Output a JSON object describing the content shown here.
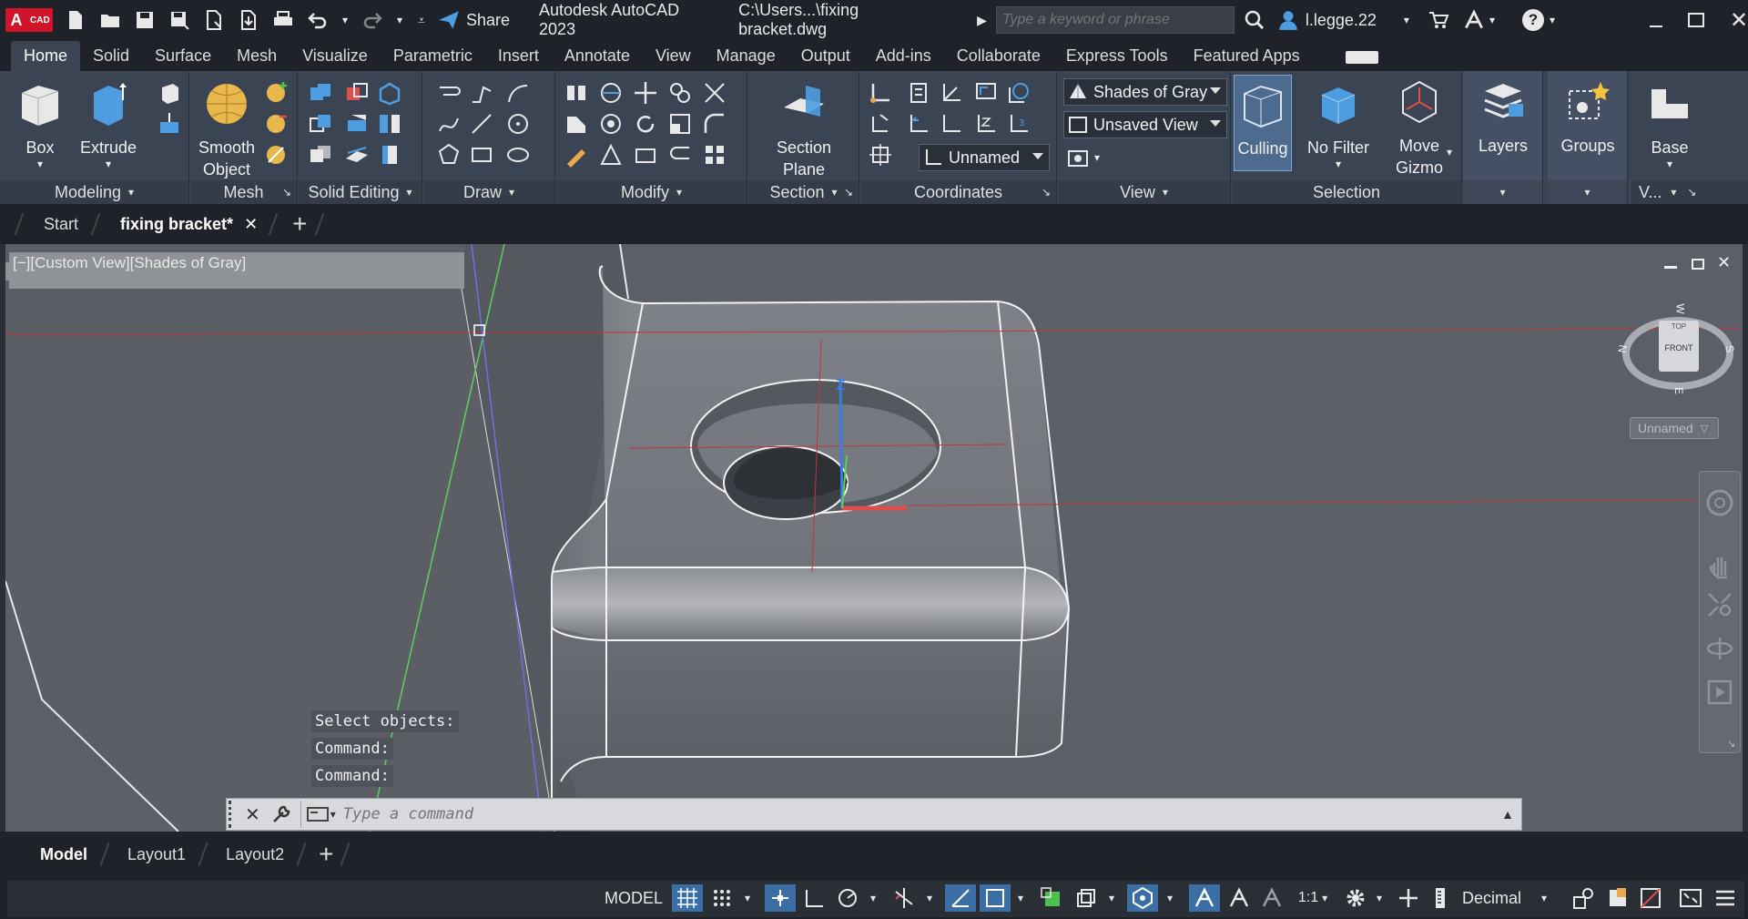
{
  "app": {
    "badge": "A",
    "badge_sub": "CAD",
    "title": "Autodesk AutoCAD 2023",
    "file": "C:\\Users...\\fixing bracket.dwg"
  },
  "quick_access": {
    "share_label": "Share"
  },
  "search": {
    "placeholder": "Type a keyword or phrase"
  },
  "user": {
    "name": "l.legge.22"
  },
  "ribbon_tabs": [
    "Home",
    "Solid",
    "Surface",
    "Mesh",
    "Visualize",
    "Parametric",
    "Insert",
    "Annotate",
    "View",
    "Manage",
    "Output",
    "Add-ins",
    "Collaborate",
    "Express Tools",
    "Featured Apps"
  ],
  "ribbon": {
    "modeling": {
      "title": "Modeling",
      "box": "Box",
      "extrude": "Extrude"
    },
    "mesh": {
      "title": "Mesh",
      "smooth1": "Smooth",
      "smooth2": "Object"
    },
    "solid_editing": {
      "title": "Solid Editing"
    },
    "draw": {
      "title": "Draw"
    },
    "modify": {
      "title": "Modify"
    },
    "section": {
      "title": "Section",
      "btn1": "Section",
      "btn2": "Plane"
    },
    "coordinates": {
      "title": "Coordinates",
      "ucs_value": "Unnamed"
    },
    "view": {
      "title": "View",
      "visual_style": "Shades of Gray",
      "saved_view": "Unsaved View"
    },
    "selection": {
      "title": "Selection",
      "culling": "Culling",
      "no_filter": "No Filter",
      "move1": "Move",
      "move2": "Gizmo"
    },
    "layers": {
      "label": "Layers"
    },
    "groups": {
      "label": "Groups"
    },
    "base": {
      "label": "Base",
      "title": "V..."
    }
  },
  "doc_tabs": {
    "start": "Start",
    "active": "fixing bracket*"
  },
  "viewport": {
    "label": "[−][Custom View][Shades of Gray]",
    "viewcube": {
      "top": "TOP",
      "front": "FRONT",
      "n": "N",
      "s": "S",
      "w": "W",
      "e": "E"
    },
    "ucs_name": "Unnamed",
    "axis_label": "Z"
  },
  "command": {
    "history": [
      "Select objects:",
      "Command:",
      "Command:"
    ],
    "placeholder": "Type a command"
  },
  "layout_tabs": [
    "Model",
    "Layout1",
    "Layout2"
  ],
  "status": {
    "model": "MODEL",
    "scale": "1:1",
    "units": "Decimal"
  },
  "colors": {
    "ribbon": "#3b4453",
    "titlebar": "#1f2329",
    "viewport": "#5a5f68",
    "accent": "#3a6ea5"
  }
}
